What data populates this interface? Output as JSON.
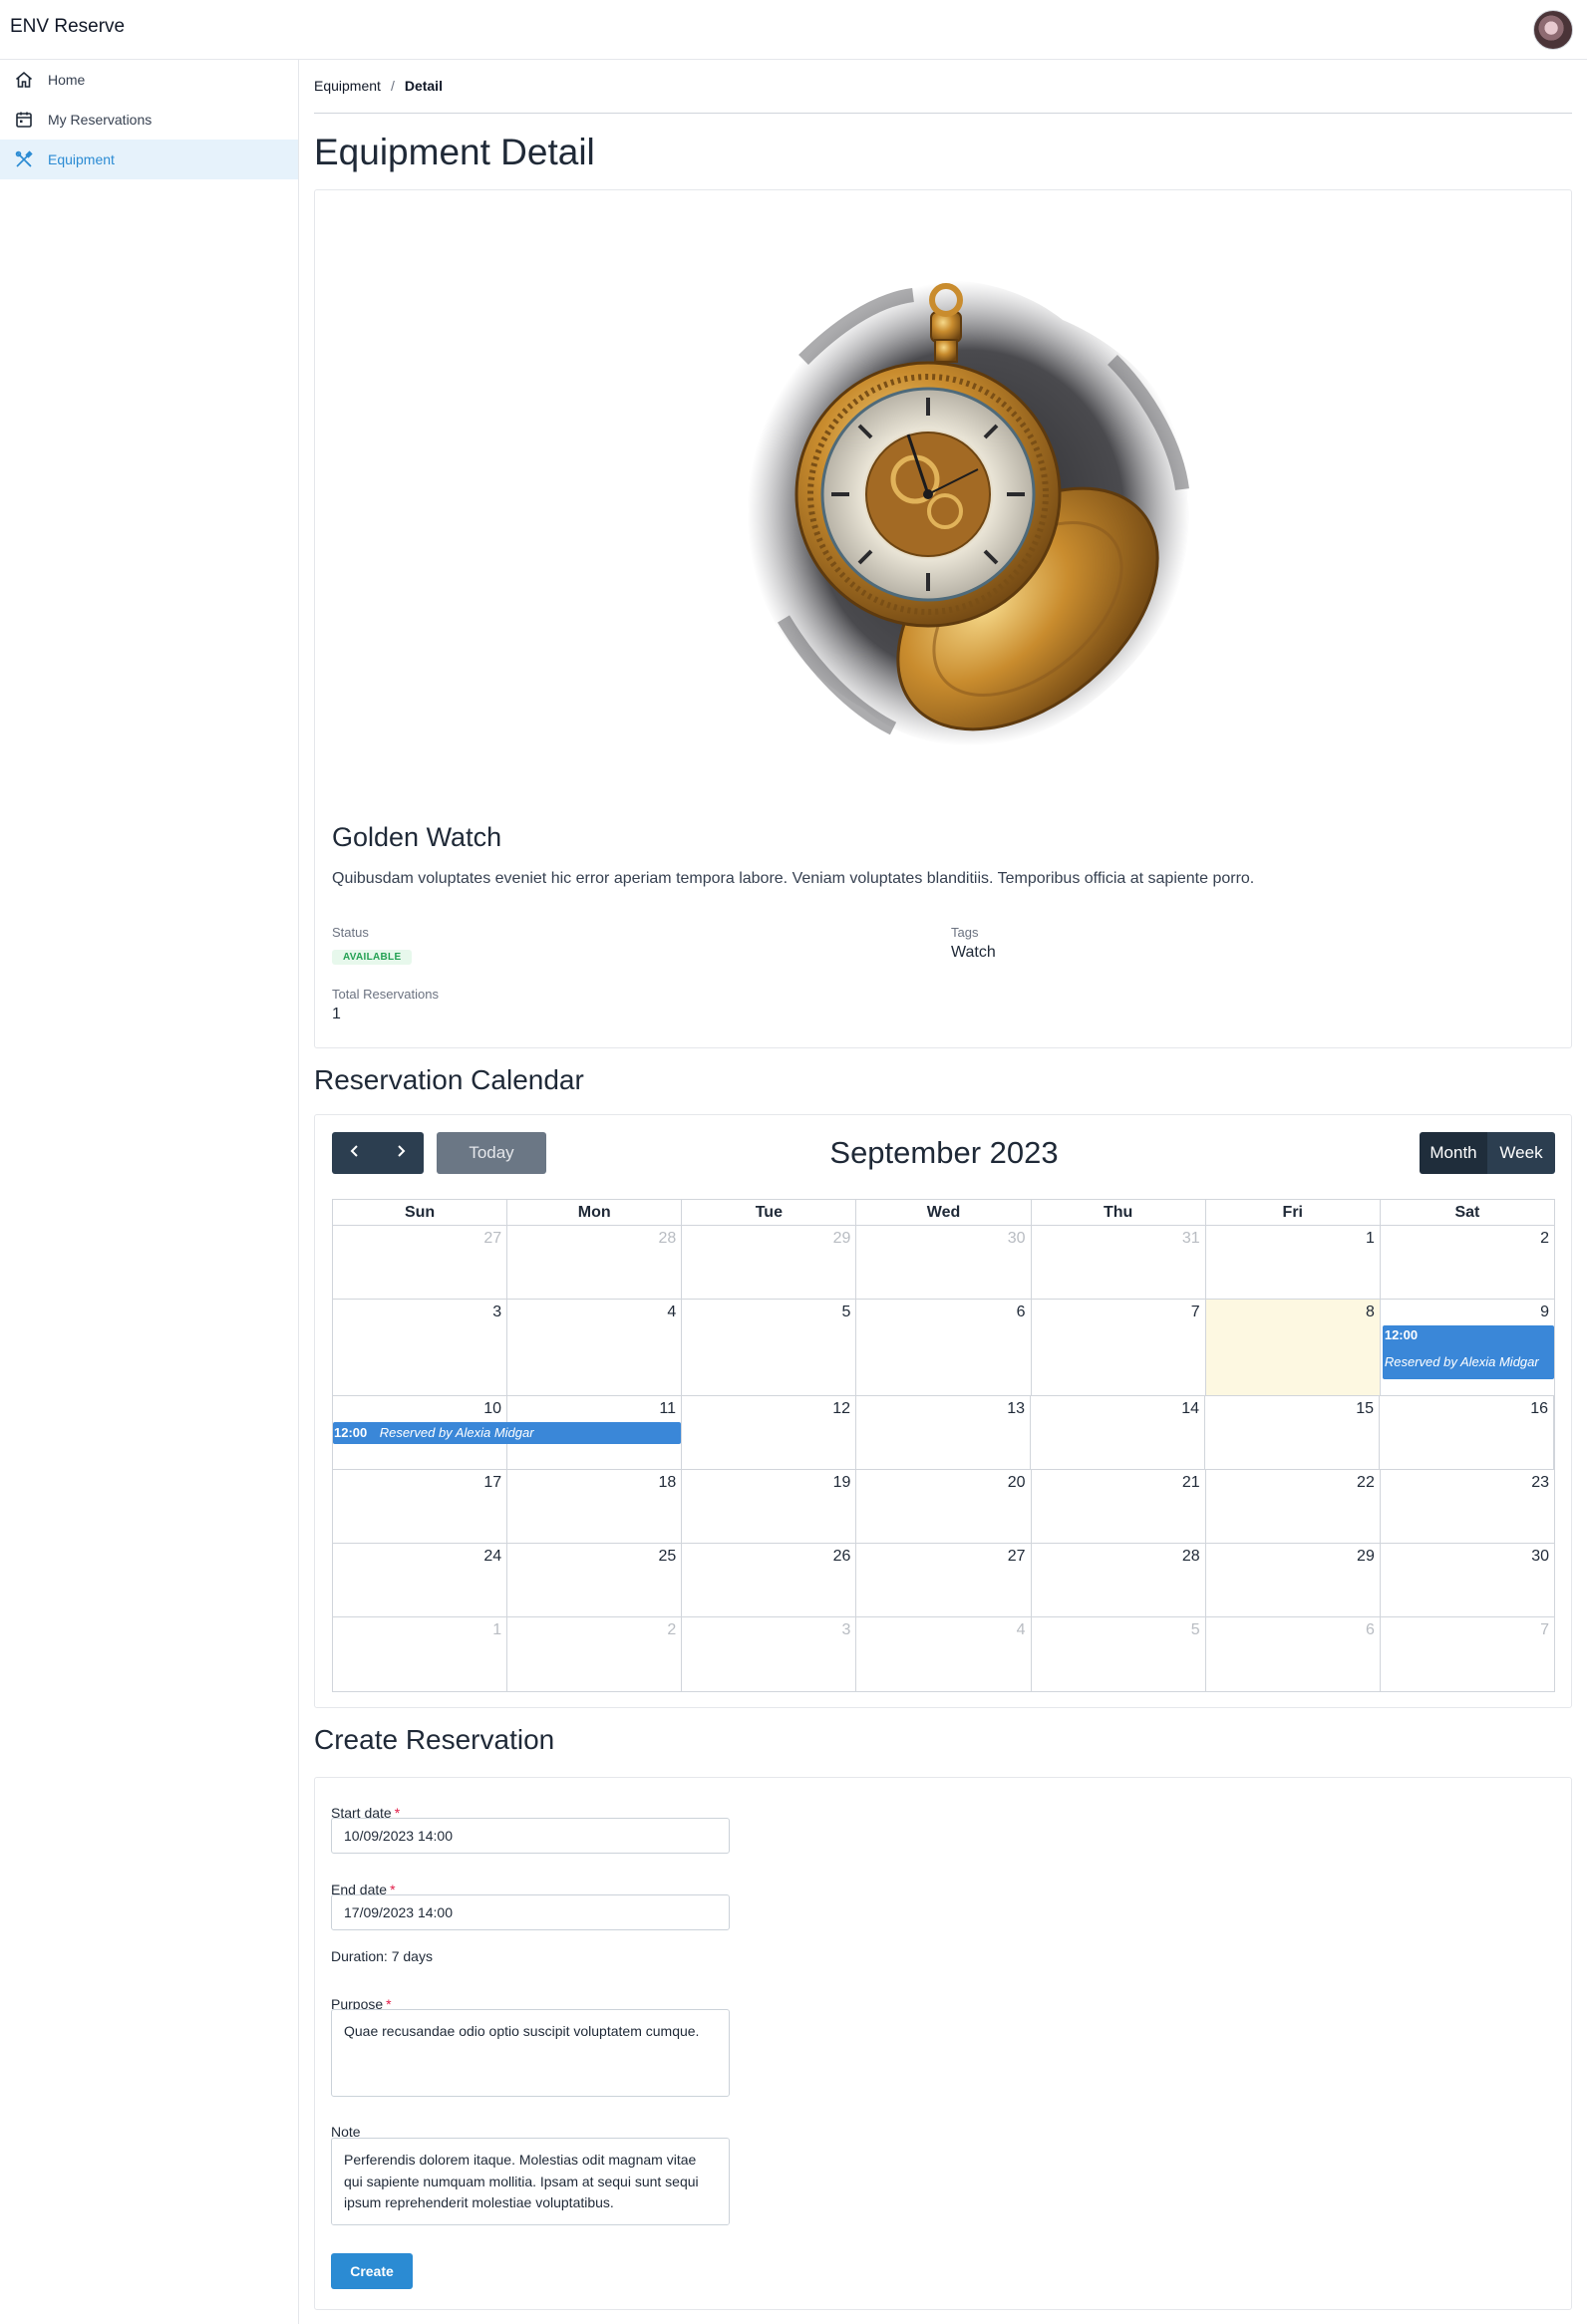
{
  "app": {
    "title": "ENV Reserve"
  },
  "sidebar": {
    "items": [
      {
        "label": "Home",
        "icon": "home-icon",
        "active": false
      },
      {
        "label": "My Reservations",
        "icon": "calendar-icon",
        "active": false
      },
      {
        "label": "Equipment",
        "icon": "tools-icon",
        "active": true
      }
    ]
  },
  "breadcrumb": {
    "parent": "Equipment",
    "separator": "/",
    "current": "Detail"
  },
  "page": {
    "title": "Equipment Detail"
  },
  "equipment": {
    "name": "Golden Watch",
    "description": "Quibusdam voluptates eveniet hic error aperiam tempora labore. Veniam voluptates blanditiis. Temporibus officia at sapiente porro.",
    "status_label": "Status",
    "status": "AVAILABLE",
    "tags_label": "Tags",
    "tags": "Watch",
    "total_label": "Total Reservations",
    "total": "1",
    "image": "golden-pocket-watch"
  },
  "calendar": {
    "heading": "Reservation Calendar",
    "title": "September 2023",
    "today_label": "Today",
    "month_label": "Month",
    "week_label": "Week",
    "days": [
      "Sun",
      "Mon",
      "Tue",
      "Wed",
      "Thu",
      "Fri",
      "Sat"
    ],
    "weeks": [
      [
        "27",
        "28",
        "29",
        "30",
        "31",
        "1",
        "2"
      ],
      [
        "3",
        "4",
        "5",
        "6",
        "7",
        "8",
        "9"
      ],
      [
        "10",
        "11",
        "12",
        "13",
        "14",
        "15",
        "16"
      ],
      [
        "17",
        "18",
        "19",
        "20",
        "21",
        "22",
        "23"
      ],
      [
        "24",
        "25",
        "26",
        "27",
        "28",
        "29",
        "30"
      ],
      [
        "1",
        "2",
        "3",
        "4",
        "5",
        "6",
        "7"
      ]
    ],
    "today_date": "8",
    "event": {
      "time": "12:00",
      "title": "Reserved by Alexia Midgar"
    },
    "colors": {
      "event": "#3a87d8",
      "today": "#fdf8e1",
      "nav": "#2c3e50"
    }
  },
  "form": {
    "heading": "Create Reservation",
    "start_label": "Start date",
    "start_value": "10/09/2023 14:00",
    "end_label": "End date",
    "end_value": "17/09/2023 14:00",
    "duration": "Duration: 7 days",
    "purpose_label": "Purpose",
    "purpose_value": "Quae recusandae odio optio suscipit voluptatem cumque.",
    "note_label": "Note",
    "note_value": "Perferendis dolorem itaque. Molestias odit magnam vitae qui sapiente numquam mollitia. Ipsam at sequi sunt sequi ipsum reprehenderit molestiae voluptatibus.",
    "required_mark": "*",
    "submit_label": "Create"
  }
}
